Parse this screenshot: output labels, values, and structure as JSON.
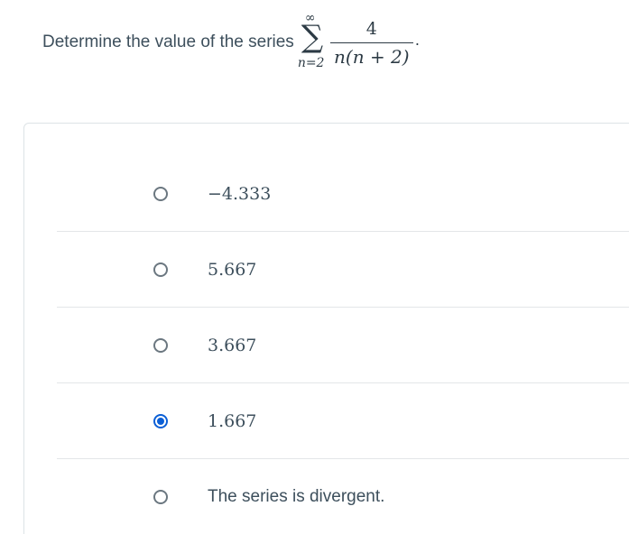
{
  "question": {
    "prefix": "Determine the value of the series",
    "sum_upper": "∞",
    "sum_symbol": "∑",
    "sum_lower": "n=2",
    "numerator": "4",
    "denominator": "n(n + 2)",
    "suffix": "."
  },
  "options": [
    {
      "label": "−4.333",
      "selected": false
    },
    {
      "label": "5.667",
      "selected": false
    },
    {
      "label": "3.667",
      "selected": false
    },
    {
      "label": "1.667",
      "selected": true
    },
    {
      "label": "The series is divergent.",
      "selected": false
    }
  ],
  "colors": {
    "accent": "#0b5fd6",
    "text": "#3d4f5c",
    "border": "#dde3e6"
  }
}
